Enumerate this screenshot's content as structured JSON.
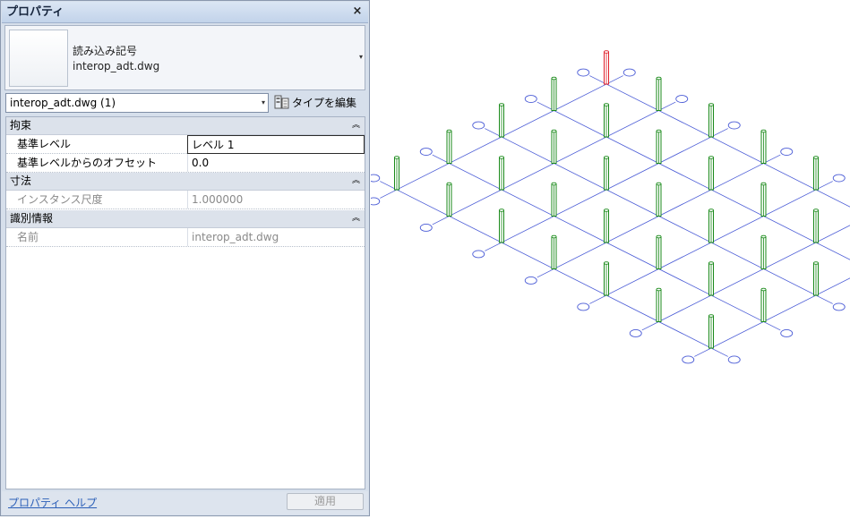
{
  "panel": {
    "title": "プロパティ",
    "close_glyph": "×",
    "type_selector": {
      "line1": "読み込み記号",
      "line2": "interop_adt.dwg",
      "arrow_glyph": "▾"
    },
    "instance_filter": {
      "value": "interop_adt.dwg (1)",
      "arrow_glyph": "▾"
    },
    "edit_type_label": "タイプを編集",
    "sections": [
      {
        "title": "拘束",
        "chevron": "︽",
        "rows": [
          {
            "label": "基準レベル",
            "value": "レベル 1",
            "editable": true
          },
          {
            "label": "基準レベルからのオフセット",
            "value": "0.0",
            "editable": false
          }
        ]
      },
      {
        "title": "寸法",
        "chevron": "︽",
        "rows": [
          {
            "label": "インスタンス尺度",
            "value": "1.000000",
            "editable": false
          }
        ]
      },
      {
        "title": "識別情報",
        "chevron": "︽",
        "rows": [
          {
            "label": "名前",
            "value": "interop_adt.dwg",
            "editable": false
          }
        ]
      }
    ],
    "help_link": "プロパティ ヘルプ",
    "apply_label": "適用"
  },
  "viewport": {
    "grid_color": "#4a5bd6",
    "column_color": "#1a8a1a",
    "selected_column_color": "#e0202a",
    "bubble_color": "#4a5bd6"
  }
}
